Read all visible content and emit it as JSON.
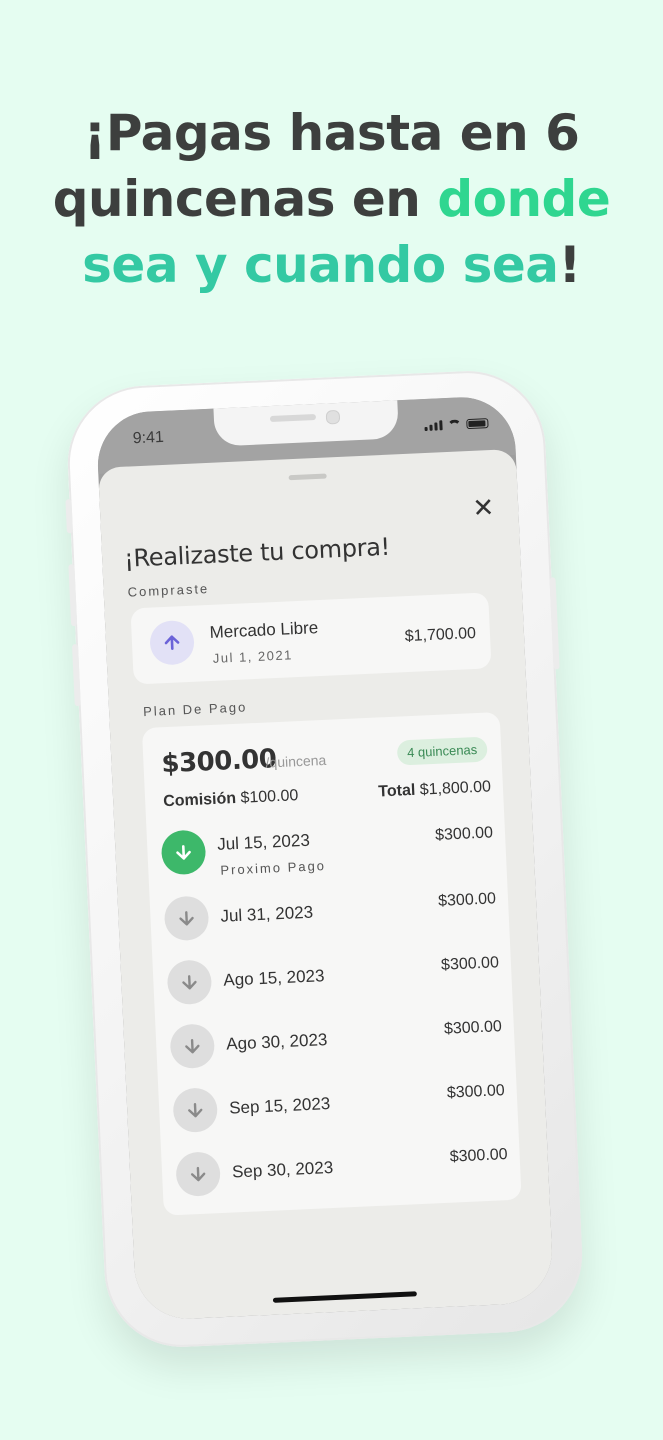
{
  "headline": {
    "line1": "¡Pagas hasta en 6",
    "line2_plain": "quincenas en ",
    "line2_accent": "donde",
    "line3_accent": "sea y cuando sea",
    "line3_end": "!"
  },
  "colors": {
    "background": "#e5fdf1",
    "accent_green": "#2fd690",
    "accent_teal": "#34c9a3",
    "pay_green": "#3db86a"
  },
  "status_bar": {
    "time": "9:41"
  },
  "sheet": {
    "close_icon": "close-icon",
    "title": "¡Realizaste tu compra!",
    "purchase_label": "Compraste",
    "purchase": {
      "merchant": "Mercado Libre",
      "date": "Jul 1, 2021",
      "amount": "$1,700.00",
      "icon": "arrow-up-icon"
    },
    "plan_label": "Plan De Pago",
    "plan": {
      "amount": "$300.00",
      "per": "/quincena",
      "badge": "4 quincenas",
      "commission_label": "Comisión",
      "commission_value": "$100.00",
      "total_label": "Total",
      "total_value": "$1,800.00",
      "payments": [
        {
          "date": "Jul 15, 2023",
          "sub": "Proximo Pago",
          "amount": "$300.00"
        },
        {
          "date": "Jul 31, 2023",
          "amount": "$300.00"
        },
        {
          "date": "Ago 15, 2023",
          "amount": "$300.00"
        },
        {
          "date": "Ago 30, 2023",
          "amount": "$300.00"
        },
        {
          "date": "Sep 15, 2023",
          "amount": "$300.00"
        },
        {
          "date": "Sep 30, 2023",
          "amount": "$300.00"
        }
      ]
    }
  }
}
